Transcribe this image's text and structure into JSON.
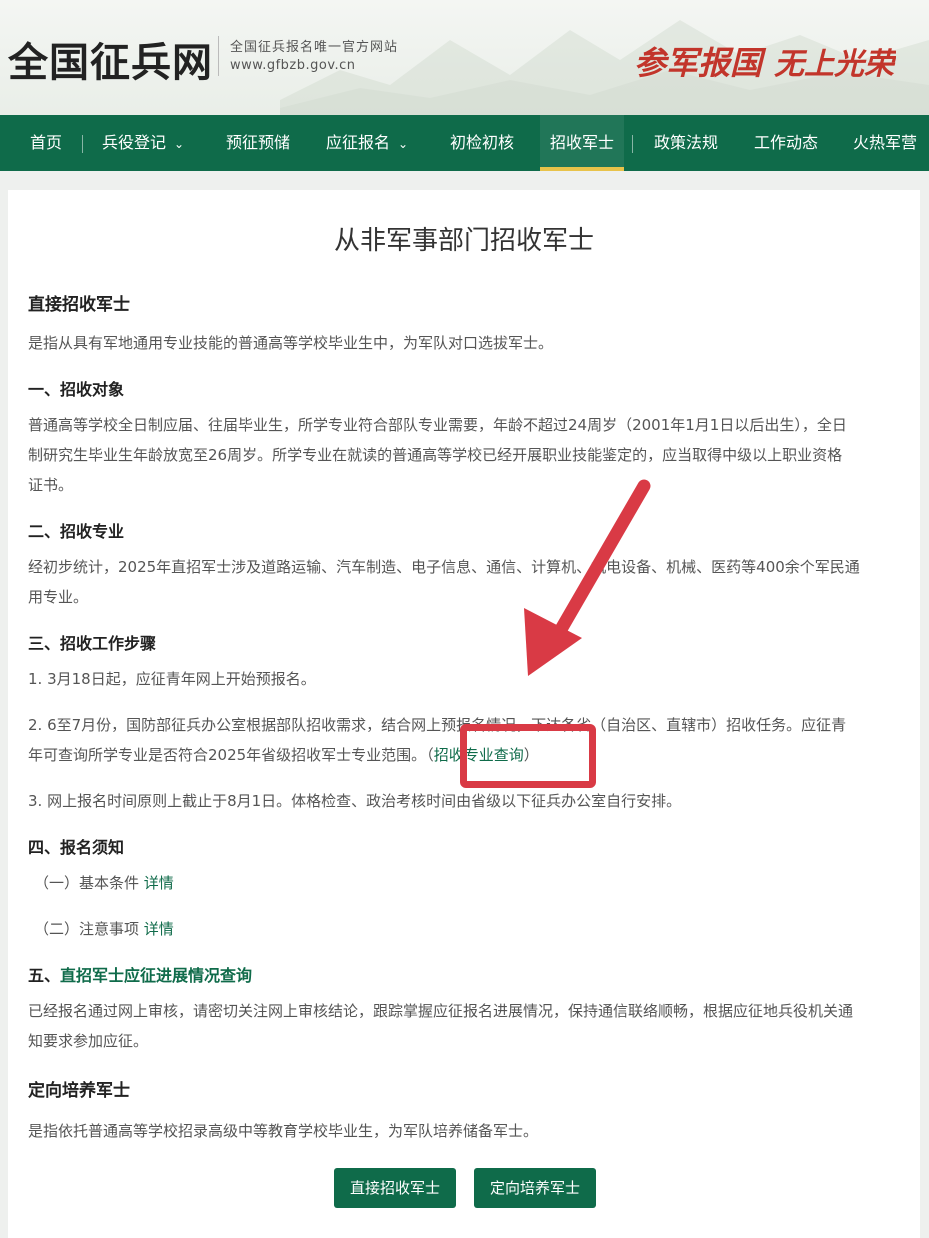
{
  "header": {
    "logo_title": "全国征兵网",
    "logo_sub": "全国征兵报名唯一官方网站",
    "logo_url": "www.gfbzb.gov.cn",
    "slogan_left": "参军报国",
    "slogan_right": "无上光荣"
  },
  "nav": {
    "items": [
      {
        "label": "首页"
      },
      {
        "label": "兵役登记"
      },
      {
        "label": "预征预储"
      },
      {
        "label": "应征报名"
      },
      {
        "label": "初检初核"
      },
      {
        "label": "招收军士"
      },
      {
        "label": "政策法规"
      },
      {
        "label": "工作动态"
      },
      {
        "label": "火热军营"
      }
    ],
    "active_index": 5,
    "accent": "#e8c34a",
    "bg": "#0f6b4a"
  },
  "main": {
    "title": "从非军事部门招收军士",
    "direct": {
      "heading": "直接招收军士",
      "intro": "是指从具有军地通用专业技能的普通高等学校毕业生中，为军队对口选拔军士。",
      "s1_heading": "一、招收对象",
      "s1_line1": "普通高等学校全日制应届、往届毕业生，所学专业符合部队专业需要，年龄不超过24周岁（2001年1月1日以后出生），全日",
      "s1_line2": "制研究生毕业生年龄放宽至26周岁。所学专业在就读的普通高等学校已经开展职业技能鉴定的，应当取得中级以上职业资格",
      "s1_line3": "证书。",
      "s2_heading": "二、招收专业",
      "s2_line1": "经初步统计，2025年直招军士涉及道路运输、汽车制造、电子信息、通信、计算机、机电设备、机械、医药等400余个军民通",
      "s2_line2": "用专业。",
      "s3_heading": "三、招收工作步骤",
      "s3_step1": "1. 3月18日起，应征青年网上开始预报名。",
      "s3_step2_line1": "2. 6至7月份，国防部征兵办公室根据部队招收需求，结合网上预报名情况，下达各省（自治区、直辖市）招收任务。应征青",
      "s3_step2_line2": "年可查询所学专业是否符合2025年省级招收军士专业范围。",
      "s3_step2_paren_open": "（",
      "s3_step2_link": "招收专业查询",
      "s3_step2_paren_close": "）",
      "s3_step3": "3. 网上报名时间原则上截止于8月1日。体格检查、政治考核时间由省级以下征兵办公室自行安排。",
      "s4_heading": "四、报名须知",
      "s4_item1_label": "（一）基本条件",
      "s4_item1_link": "详情",
      "s4_item2_label": "（二）注意事项",
      "s4_item2_link": "详情",
      "s5_prefix": "五、",
      "s5_link": "直招军士应征进展情况查询",
      "s5_line1": "已经报名通过网上审核，请密切关注网上审核结论，跟踪掌握应征报名进展情况，保持通信联络顺畅，根据应征地兵役机关通",
      "s5_line2": "知要求参加应征。"
    },
    "directed": {
      "heading": "定向培养军士",
      "intro": "是指依托普通高等学校招录高级中等教育学校毕业生，为军队培养储备军士。"
    },
    "buttons": {
      "direct": "直接招收军士",
      "directed": "定向培养军士"
    }
  },
  "annotation_color": "#d93a45"
}
